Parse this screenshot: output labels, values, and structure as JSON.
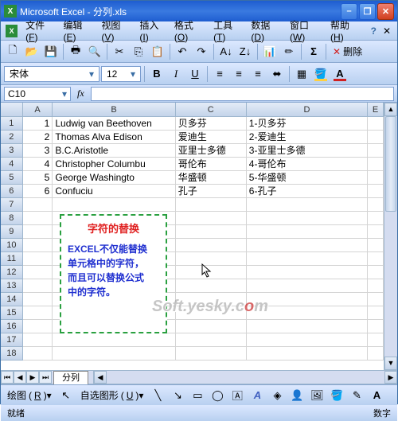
{
  "window": {
    "title": "Microsoft Excel - 分列.xls"
  },
  "menus": {
    "file": "文件",
    "file_u": "F",
    "edit": "编辑",
    "edit_u": "E",
    "view": "视图",
    "view_u": "V",
    "insert": "插入",
    "insert_u": "I",
    "format": "格式",
    "format_u": "O",
    "tools": "工具",
    "tools_u": "T",
    "data": "数据",
    "data_u": "D",
    "window": "窗口",
    "window_u": "W",
    "help": "帮助",
    "help_u": "H"
  },
  "toolbar": {
    "delete_label": "删除"
  },
  "format": {
    "font_name": "宋体",
    "font_size": "12",
    "bold": "B",
    "italic": "I",
    "underline": "U"
  },
  "formula": {
    "cell_ref": "C10",
    "fx": "fx",
    "value": ""
  },
  "cols": {
    "A": "A",
    "B": "B",
    "C": "C",
    "D": "D",
    "E": "E"
  },
  "col_widths": {
    "A": 38,
    "B": 156,
    "C": 90,
    "D": 154,
    "E": 20
  },
  "grid": {
    "r1": {
      "a": "1",
      "b": "Ludwig van Beethoven",
      "c": "贝多芬",
      "d": "1-贝多芬"
    },
    "r2": {
      "a": "2",
      "b": "Thomas Alva Edison",
      "c": "爱迪生",
      "d": "2-爱迪生"
    },
    "r3": {
      "a": "3",
      "b": "B.C.Aristotle",
      "c": "亚里士多德",
      "d": "3-亚里士多德"
    },
    "r4": {
      "a": "4",
      "b": "Christopher Columbu",
      "c": "哥伦布",
      "d": "4-哥伦布"
    },
    "r5": {
      "a": "5",
      "b": "George Washingto",
      "c": "华盛顿",
      "d": "5-华盛顿"
    },
    "r6": {
      "a": "6",
      "b": "Confuciu",
      "c": "孔子",
      "d": "6-孔子"
    }
  },
  "textbox": {
    "title": "字符的替换",
    "line1": "EXCEL不仅能替换",
    "line2": "单元格中的字符，",
    "line3": "而且可以替换公式",
    "line4": "中的字符。"
  },
  "watermark": {
    "t1": "Soft.yesky.c",
    "t2": "o",
    "t3": "m"
  },
  "sheet": {
    "name": "分列"
  },
  "drawbar": {
    "draw": "绘图",
    "draw_u": "R",
    "autoshapes": "自选图形",
    "autoshapes_u": "U"
  },
  "status": {
    "ready": "就绪",
    "num": "数字"
  }
}
